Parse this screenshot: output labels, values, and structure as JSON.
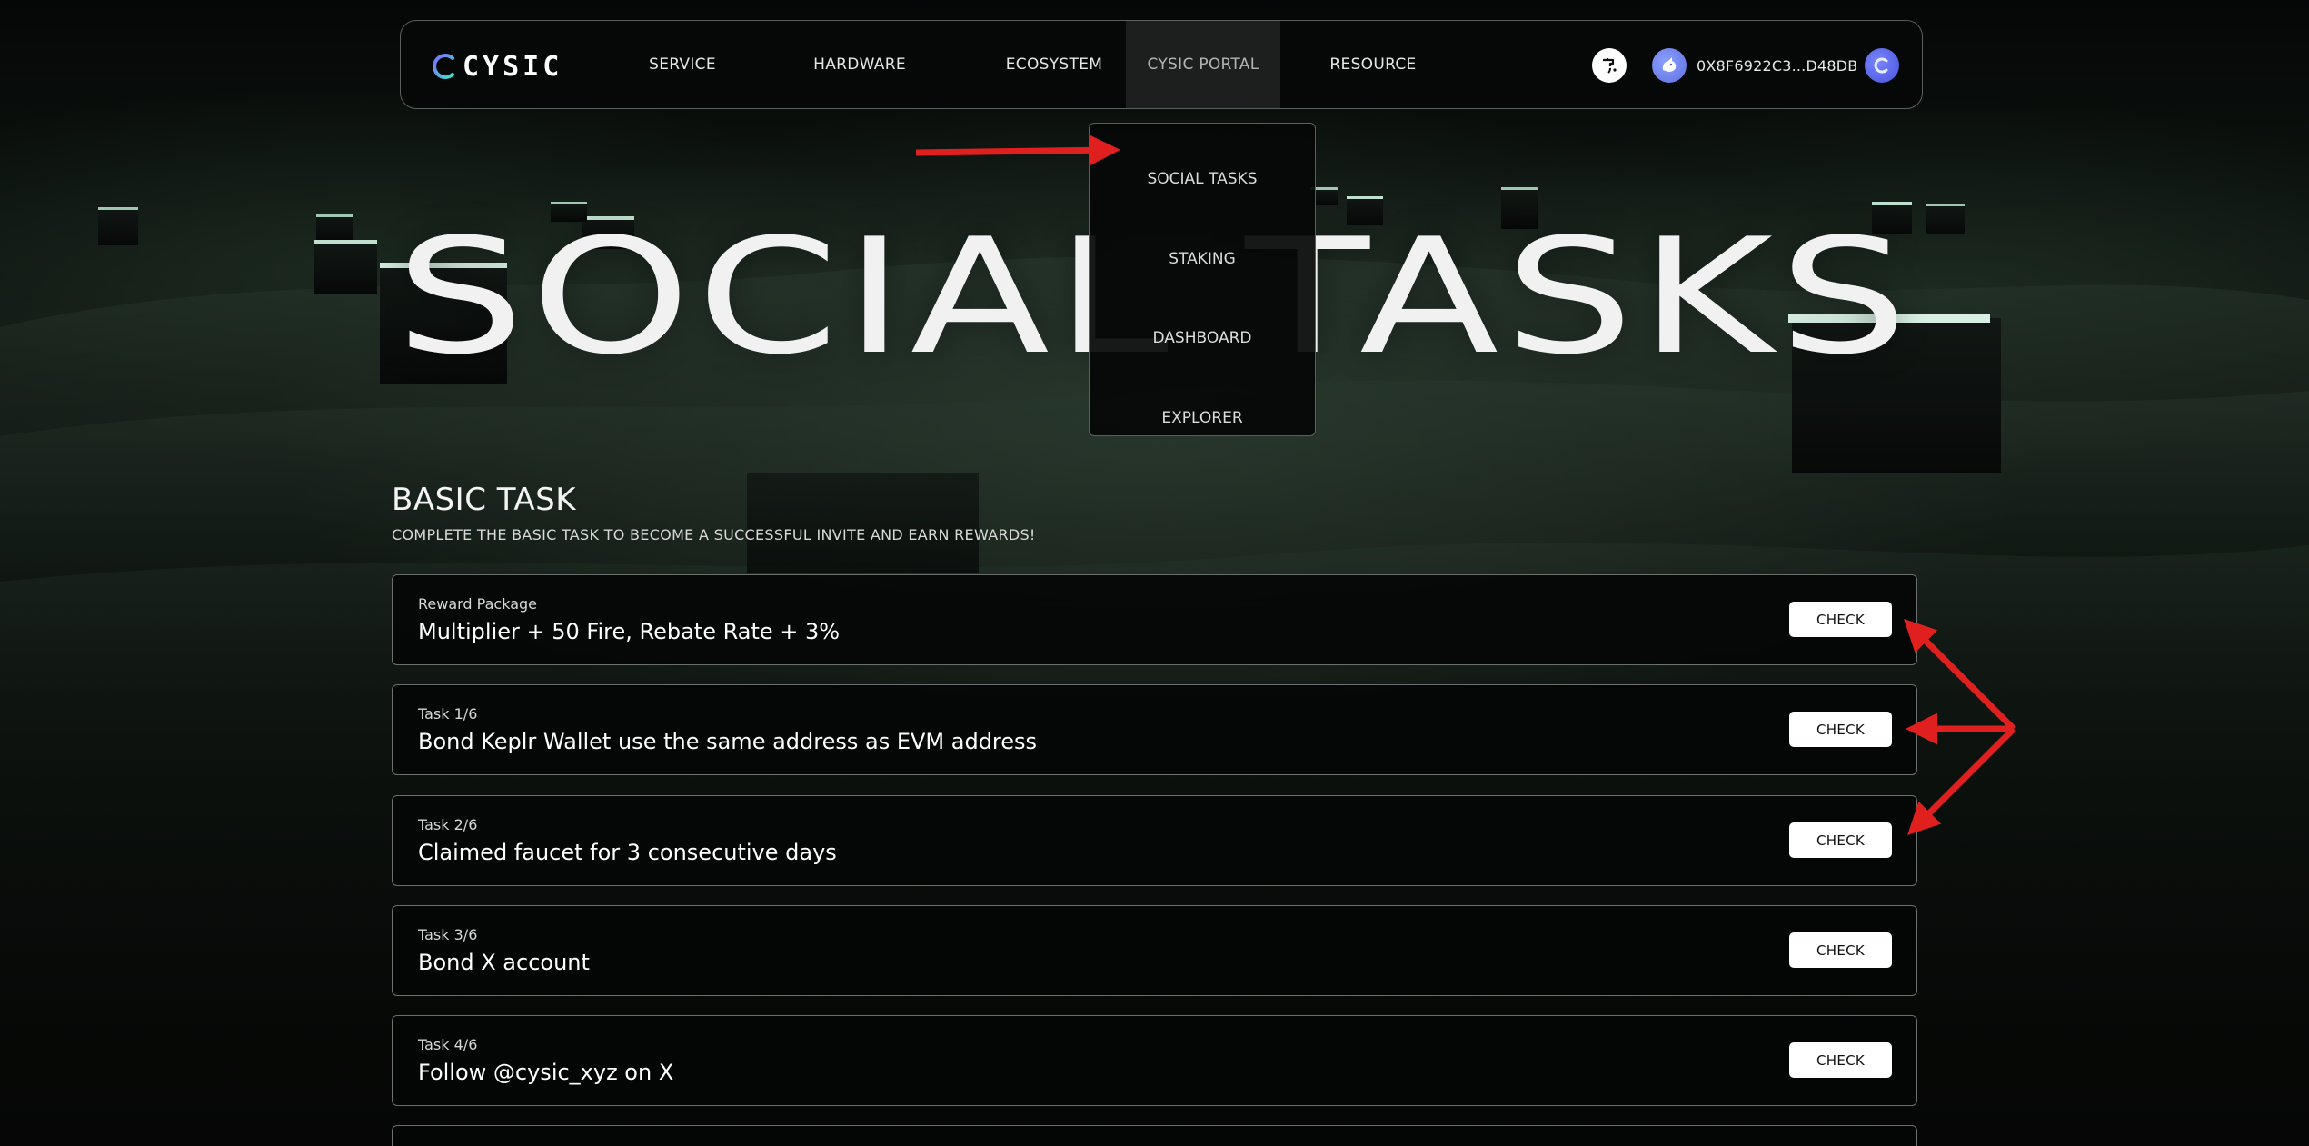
{
  "brand": {
    "logo_text": "CYSIC"
  },
  "nav": {
    "items": [
      {
        "label": "SERVICE"
      },
      {
        "label": "HARDWARE"
      },
      {
        "label": "ECOSYSTEM"
      },
      {
        "label": "CYSIC PORTAL",
        "active": true
      },
      {
        "label": "RESOURCE"
      }
    ],
    "wallet_address": "0X8F6922C3...D48DB"
  },
  "dropdown": {
    "items": [
      {
        "label": "SOCIAL TASKS"
      },
      {
        "label": "STAKING"
      },
      {
        "label": "DASHBOARD"
      },
      {
        "label": "EXPLORER"
      }
    ]
  },
  "hero": {
    "title": "SOCIAL TASKS"
  },
  "basic_task": {
    "title": "BASIC TASK",
    "subtitle": "COMPLETE THE BASIC TASK TO BECOME A SUCCESSFUL INVITE AND EARN REWARDS!",
    "cards": [
      {
        "label": "Reward Package",
        "title": "Multiplier + 50 Fire, Rebate Rate + 3%",
        "button": "CHECK"
      },
      {
        "label": "Task 1/6",
        "title": "Bond Keplr Wallet use the same address as EVM address",
        "button": "CHECK"
      },
      {
        "label": "Task 2/6",
        "title": "Claimed faucet for 3 consecutive days",
        "button": "CHECK"
      },
      {
        "label": "Task 3/6",
        "title": "Bond X account",
        "button": "CHECK"
      },
      {
        "label": "Task 4/6",
        "title": "Follow @cysic_xyz on X",
        "button": "CHECK"
      }
    ]
  },
  "colors": {
    "annotation_arrow": "#e0201e",
    "border": "#6b6f6d",
    "card_bg": "#040505",
    "button_bg": "#ffffff",
    "wallet_avatar": "#6f7ff0"
  },
  "icons": {
    "logo": "cysic-c-logo-icon",
    "faucet": "faucet-icon",
    "wallet_avatar": "unicorn-avatar-icon",
    "chain": "cysic-chain-icon"
  }
}
